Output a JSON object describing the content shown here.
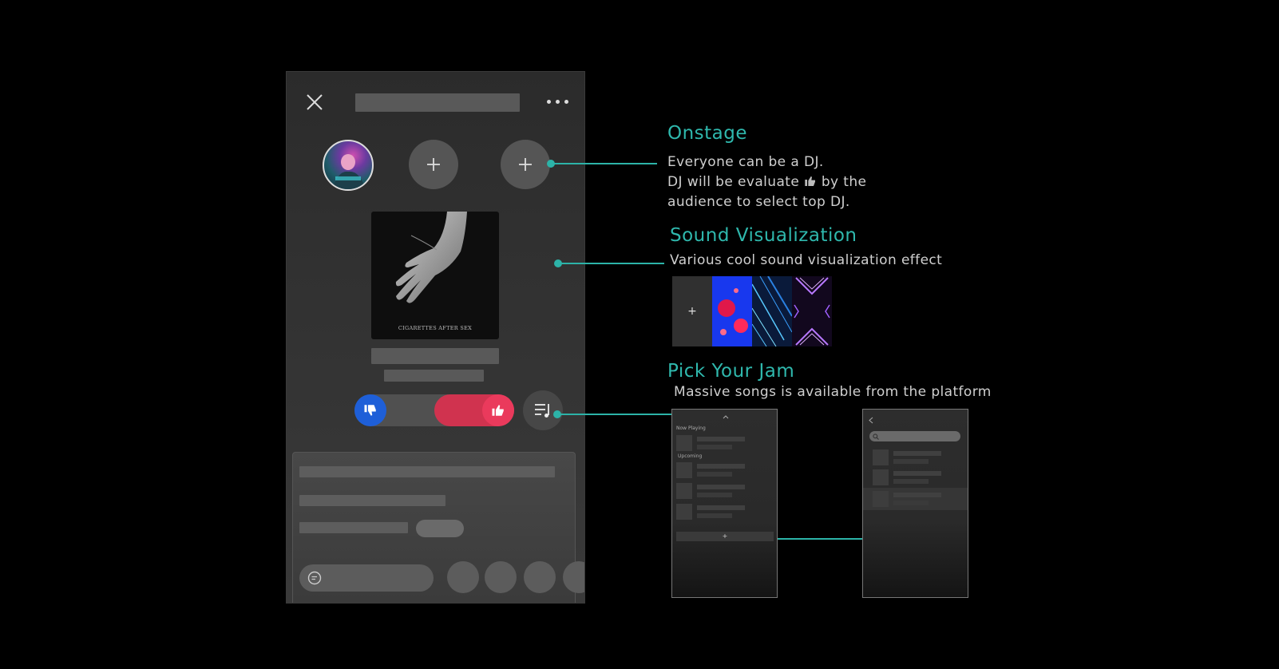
{
  "phone": {
    "close_icon": "close-icon",
    "more_icon": "more-icon",
    "album_caption": "CIGARETTES AFTER SEX",
    "chat_icon": "chat-icon",
    "colors": {
      "dislike": "#1e5fd8",
      "like": "#e0385a"
    }
  },
  "annotations": {
    "onstage": {
      "title": "Onstage",
      "line1": "Everyone can be a DJ.",
      "line2a": "DJ will be evaluate",
      "line2b": "by the",
      "line3": "audience to select top DJ."
    },
    "sound": {
      "title": "Sound Visualization",
      "desc": "Various cool sound visualization effect",
      "tiles": [
        "+",
        "red-jellyfish",
        "blue-light-streaks",
        "purple-neon-diamonds"
      ]
    },
    "jam": {
      "title": "Pick Your Jam",
      "desc": "Massive songs is available from the platform",
      "now_playing": "Now Playing",
      "upcoming": "Upcoming",
      "add": "+"
    }
  },
  "accent_color": "#2cb3a8"
}
